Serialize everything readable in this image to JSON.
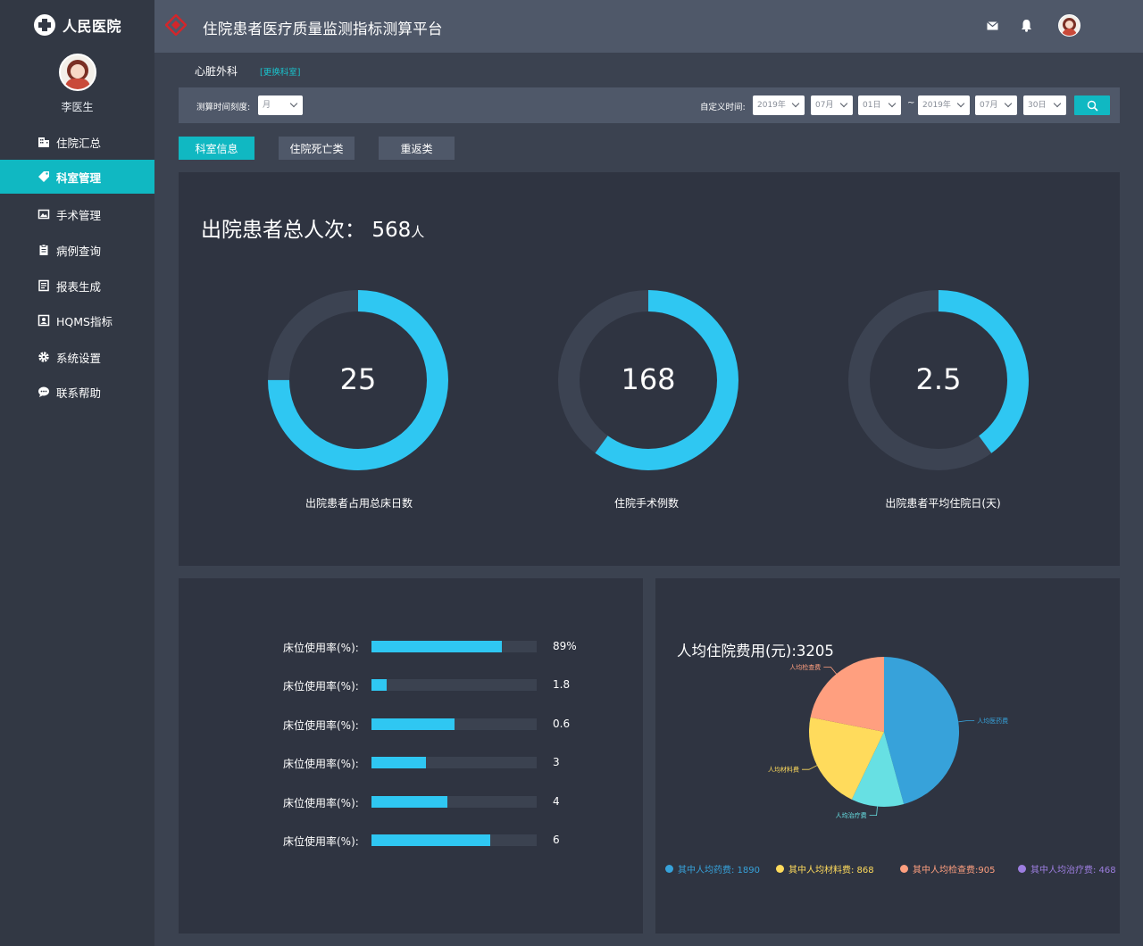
{
  "sidebar": {
    "brand": "人民医院",
    "doctor_name": "李医生",
    "items": [
      {
        "label": "住院汇总",
        "icon": "building-icon"
      },
      {
        "label": "科室管理",
        "icon": "tag-icon"
      },
      {
        "label": "手术管理",
        "icon": "image-icon"
      },
      {
        "label": "病例查询",
        "icon": "clipboard-icon"
      },
      {
        "label": "报表生成",
        "icon": "report-icon"
      },
      {
        "label": "HQMS指标",
        "icon": "id-card-icon"
      },
      {
        "label": "系统设置",
        "icon": "gear-icon"
      },
      {
        "label": "联系帮助",
        "icon": "chat-icon"
      }
    ],
    "active_index": 1
  },
  "header": {
    "title": "住院患者医疗质量监测指标测算平台",
    "icons": [
      "mail-icon",
      "bell-icon",
      "avatar"
    ]
  },
  "department": {
    "name": "心脏外科",
    "change_link": "[更换科室]"
  },
  "filters": {
    "scale_label": "测算时间刻度:",
    "scale_value": "月",
    "custom_label": "自定义时间:",
    "start": {
      "year": "2019年",
      "month": "07月",
      "day": "01日"
    },
    "separator": "~",
    "end": {
      "year": "2019年",
      "month": "07月",
      "day": "30日"
    }
  },
  "tabs": [
    "科室信息",
    "住院死亡类",
    "重返类"
  ],
  "summary": {
    "label": "出院患者总人次：",
    "value": "568",
    "unit": "人"
  },
  "donuts": [
    {
      "value": "25",
      "label": "出院患者占用总床日数",
      "fraction": 0.75
    },
    {
      "value": "168",
      "label": "住院手术例数",
      "fraction": 0.6
    },
    {
      "value": "2.5",
      "label": "出院患者平均住院日(天)",
      "fraction": 0.4
    }
  ],
  "bars": [
    {
      "label": "床位使用率(%):",
      "value": "89%",
      "fraction": 0.79
    },
    {
      "label": "床位使用率(%):",
      "value": "1.8",
      "fraction": 0.09
    },
    {
      "label": "床位使用率(%):",
      "value": "0.6",
      "fraction": 0.5
    },
    {
      "label": "床位使用率(%):",
      "value": "3",
      "fraction": 0.33
    },
    {
      "label": "床位使用率(%):",
      "value": "4",
      "fraction": 0.46
    },
    {
      "label": "床位使用率(%):",
      "value": "6",
      "fraction": 0.72
    }
  ],
  "pie": {
    "title": "人均住院费用(元):3205",
    "slices": [
      {
        "name": "人均医药费",
        "value": 1890,
        "color": "#37a2da"
      },
      {
        "name": "人均治疗费",
        "value": 468,
        "color": "#67e0e3"
      },
      {
        "name": "人均材料费",
        "value": 868,
        "color": "#ffdb5c"
      },
      {
        "name": "人均检查费",
        "value": 905,
        "color": "#ff9f7f"
      }
    ],
    "legend": [
      {
        "text": "其中人均药费: 1890",
        "color": "#37a2da"
      },
      {
        "text": "其中人均材料费: 868",
        "color": "#ffdb5c"
      },
      {
        "text": "其中人均检查费:905",
        "color": "#ff9f7f"
      },
      {
        "text": "其中人均治疗费: 468",
        "color": "#9d7ee0"
      }
    ]
  },
  "colors": {
    "accent": "#10b8c2",
    "ring": "#2fc7f2",
    "ring_track": "#3c4352"
  }
}
